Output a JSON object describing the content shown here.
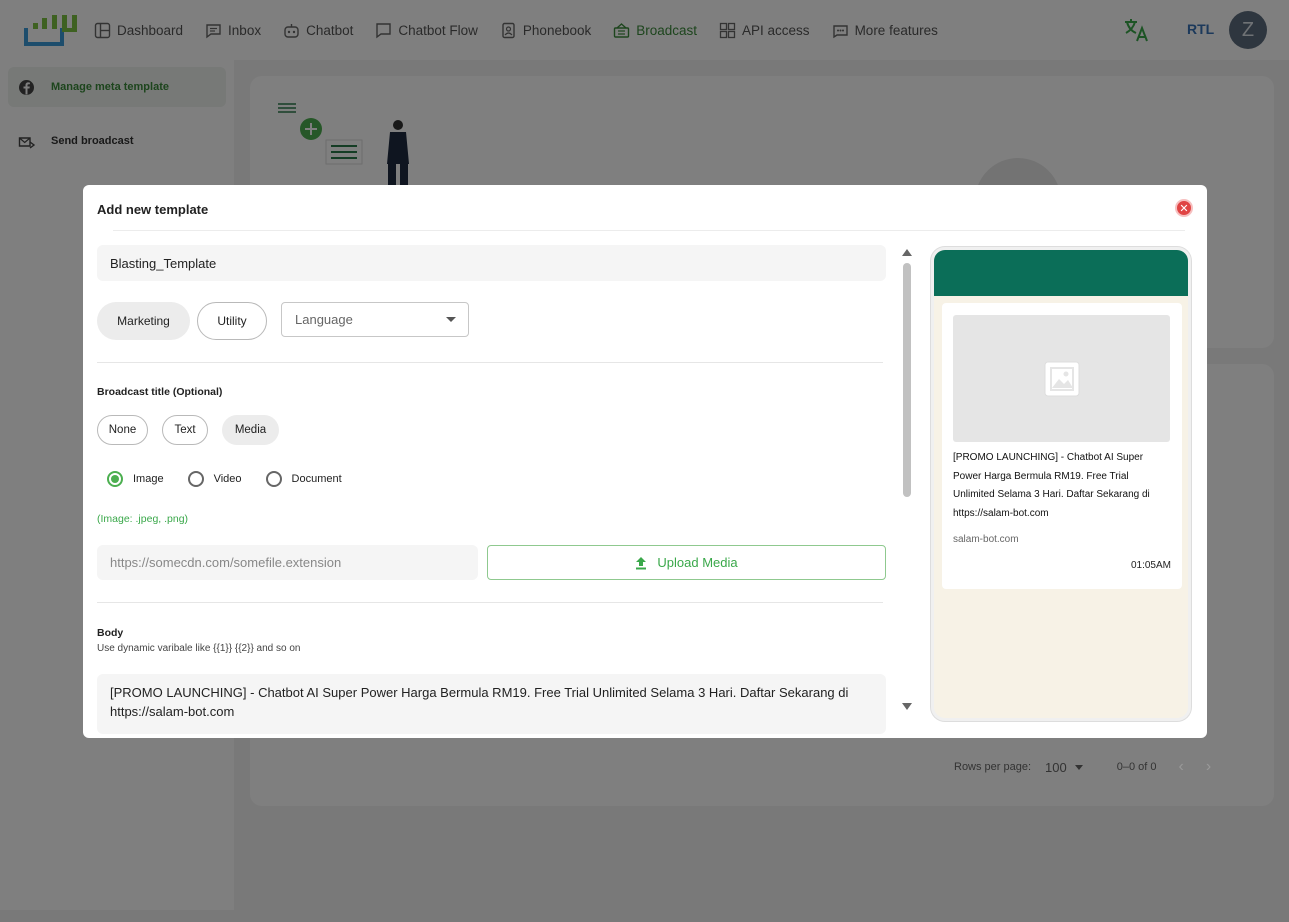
{
  "nav": {
    "items": [
      {
        "label": "Dashboard",
        "icon": "dashboard-icon"
      },
      {
        "label": "Inbox",
        "icon": "inbox-icon"
      },
      {
        "label": "Chatbot",
        "icon": "chatbot-icon"
      },
      {
        "label": "Chatbot Flow",
        "icon": "chatbot-flow-icon"
      },
      {
        "label": "Phonebook",
        "icon": "phonebook-icon"
      },
      {
        "label": "Broadcast",
        "icon": "broadcast-icon"
      },
      {
        "label": "API access",
        "icon": "api-icon"
      },
      {
        "label": "More features",
        "icon": "more-features-icon"
      }
    ],
    "active": "Broadcast",
    "rtl_label": "RTL",
    "avatar_initial": "Z"
  },
  "sidebar": {
    "items": [
      {
        "label": "Manage meta template",
        "icon": "facebook-icon"
      },
      {
        "label": "Send broadcast",
        "icon": "send-broadcast-icon"
      }
    ]
  },
  "pagination": {
    "rows_label": "Rows per page:",
    "rows_value": "100",
    "range": "0–0 of 0"
  },
  "modal": {
    "title": "Add new template",
    "template_name": "Blasting_Template",
    "categories": [
      "Marketing",
      "Utility"
    ],
    "selected_category": "Marketing",
    "language_placeholder": "Language",
    "broadcast_title_label": "Broadcast title (Optional)",
    "title_types": [
      "None",
      "Text",
      "Media"
    ],
    "selected_title_type": "Media",
    "media_types": [
      "Image",
      "Video",
      "Document"
    ],
    "selected_media_type": "Image",
    "media_hint": "(Image: .jpeg, .png)",
    "media_url_placeholder": "https://somecdn.com/somefile.extension",
    "upload_label": "Upload Media",
    "body_label": "Body",
    "body_hint": "Use dynamic varibale like {{1}} {{2}} and so on",
    "body_text": "[PROMO LAUNCHING] - Chatbot AI Super Power Harga Bermula RM19. Free Trial Unlimited Selama 3 Hari. Daftar Sekarang di https://salam-bot.com"
  },
  "preview": {
    "message": "[PROMO LAUNCHING] - Chatbot AI Super Power Harga Bermula RM19. Free Trial Unlimited Selama 3 Hari. Daftar Sekarang di https://salam-bot.com",
    "footer": "salam-bot.com",
    "time": "01:05AM"
  },
  "colors": {
    "accent": "#3a8a3a",
    "whatsapp_header": "#0b6e58",
    "chat_bg": "#f7f2e6",
    "close": "#e04444"
  }
}
